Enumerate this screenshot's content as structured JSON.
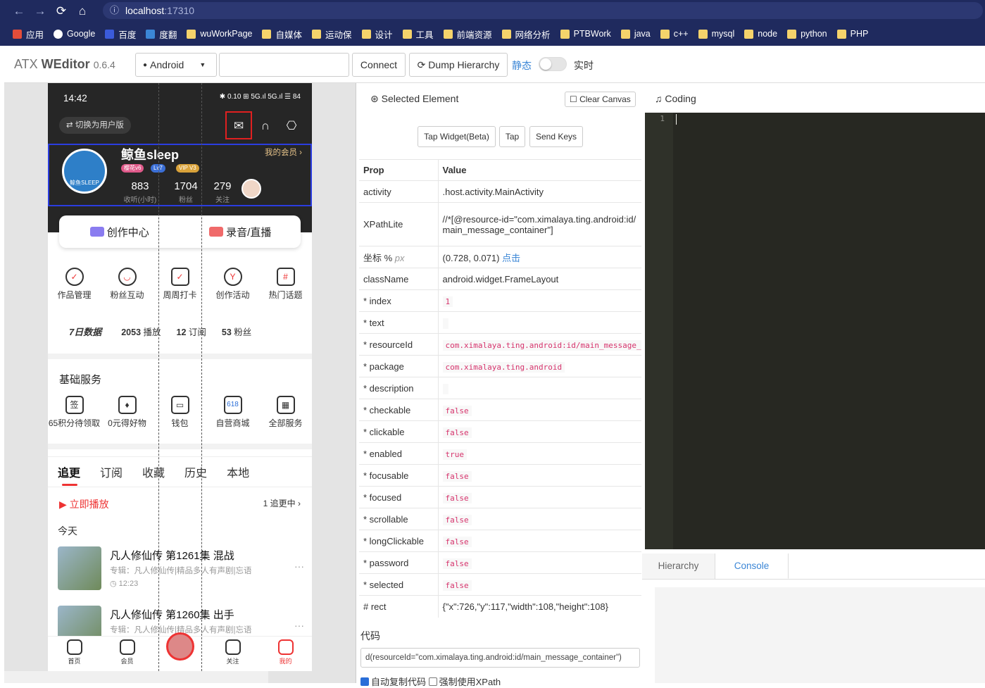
{
  "browser": {
    "url_host": "localhost",
    "url_port": ":17310",
    "nav": [
      "←",
      "→",
      "⟳",
      "⌂"
    ]
  },
  "bookmarks": [
    {
      "label": "应用",
      "icon": "apps-grid-icon",
      "color": "#e44d3a"
    },
    {
      "label": "Google",
      "icon": "google-icon",
      "color": "#ffffff"
    },
    {
      "label": "百度",
      "icon": "baidu-icon",
      "color": "#3b5bdb"
    },
    {
      "label": "度翻",
      "icon": "fanyi-icon",
      "color": "#3b86d6"
    },
    {
      "label": "wuWorkPage",
      "icon": "folder-icon"
    },
    {
      "label": "自媒体",
      "icon": "folder-icon"
    },
    {
      "label": "运动保",
      "icon": "folder-icon"
    },
    {
      "label": "设计",
      "icon": "folder-icon"
    },
    {
      "label": "工具",
      "icon": "folder-icon"
    },
    {
      "label": "前端资源",
      "icon": "folder-icon"
    },
    {
      "label": "网络分析",
      "icon": "folder-icon"
    },
    {
      "label": "PTBWork",
      "icon": "folder-icon"
    },
    {
      "label": "java",
      "icon": "folder-icon"
    },
    {
      "label": "c++",
      "icon": "folder-icon"
    },
    {
      "label": "mysql",
      "icon": "folder-icon"
    },
    {
      "label": "node",
      "icon": "folder-icon"
    },
    {
      "label": "python",
      "icon": "folder-icon"
    },
    {
      "label": "PHP",
      "icon": "folder-icon"
    }
  ],
  "app": {
    "brand_light": "ATX ",
    "brand_bold": "WEditor",
    "version": "0.6.4",
    "platform": "Android",
    "connect": "Connect",
    "dump": "Dump Hierarchy",
    "static_label": "静态",
    "realtime_label": "实时",
    "serial_placeholder": ""
  },
  "phone": {
    "time": "14:42",
    "status_icons": "✱ 0.10 ⊞ 5G.ıl 5G.ıl ☰ 84",
    "switch_user": "切换为用户版",
    "username": "鲸鱼sleep",
    "member": "我的会员 ›",
    "badges": [
      "樱花v6",
      "Lv7",
      "VIP V3"
    ],
    "stats": [
      {
        "n": "883",
        "l": "收听(小时)"
      },
      {
        "n": "1704",
        "l": "粉丝"
      },
      {
        "n": "279",
        "l": "关注"
      }
    ],
    "avatar_text": "鲸鱼SLEEP",
    "create": [
      {
        "label": "创作中心"
      },
      {
        "label": "录音/直播"
      }
    ],
    "tools": [
      {
        "label": "作品管理",
        "icon": "✓"
      },
      {
        "label": "粉丝互动",
        "icon": "◡"
      },
      {
        "label": "周周打卡",
        "icon": "✓"
      },
      {
        "label": "创作活动",
        "icon": "Y"
      },
      {
        "label": "热门话题",
        "icon": "#"
      }
    ],
    "data7": {
      "title": "7日数据",
      "items": [
        {
          "n": "2053",
          "l": " 播放"
        },
        {
          "n": "12",
          "l": " 订阅"
        },
        {
          "n": "53",
          "l": " 粉丝"
        }
      ]
    },
    "basic_title": "基础服务",
    "services": [
      {
        "label": "65积分待领取",
        "icon": "签"
      },
      {
        "label": "0元得好物",
        "icon": "♦"
      },
      {
        "label": "钱包",
        "icon": "▭"
      },
      {
        "label": "自营商城",
        "icon": "618"
      },
      {
        "label": "全部服务",
        "icon": "▦"
      }
    ],
    "tabs": [
      "追更",
      "订阅",
      "收藏",
      "历史",
      "本地"
    ],
    "playnow": "▶ 立即播放",
    "follow_count": "1 追更中 ›",
    "today": "今天",
    "episodes": [
      {
        "title": "凡人修仙传 第1261集 混战",
        "sub": "专辑：凡人修仙传|精品多人有声剧|忘语",
        "dur": "◷ 12:23"
      },
      {
        "title": "凡人修仙传 第1260集 出手",
        "sub": "专辑：凡人修仙传|精品多人有声剧|忘语",
        "dur": ""
      }
    ],
    "bottom_nav": [
      "首页",
      "会员",
      "",
      "关注",
      "我的"
    ]
  },
  "selected": {
    "title": "Selected Element",
    "clear": "Clear Canvas",
    "actions": [
      "Tap Widget(Beta)",
      "Tap",
      "Send Keys"
    ]
  },
  "props": {
    "head_prop": "Prop",
    "head_value": "Value",
    "rows": [
      {
        "k": "activity",
        "v": ".host.activity.MainActivity",
        "type": "text"
      },
      {
        "k": "XPathLite",
        "v": "//*[@resource-id=\"com.ximalaya.ting.android:id/main_message_container\"]",
        "type": "text"
      },
      {
        "k": "坐标 %",
        "v": "(0.728, 0.071)",
        "type": "coord",
        "unit": "px",
        "link": "点击"
      },
      {
        "k": "className",
        "v": "android.widget.FrameLayout",
        "type": "text"
      },
      {
        "k": "* index",
        "v": "1",
        "type": "code"
      },
      {
        "k": "* text",
        "v": "",
        "type": "code"
      },
      {
        "k": "* resourceId",
        "v": "com.ximalaya.ting.android:id/main_message_container",
        "type": "code"
      },
      {
        "k": "* package",
        "v": "com.ximalaya.ting.android",
        "type": "code"
      },
      {
        "k": "* description",
        "v": "",
        "type": "code"
      },
      {
        "k": "* checkable",
        "v": "false",
        "type": "code"
      },
      {
        "k": "* clickable",
        "v": "false",
        "type": "code"
      },
      {
        "k": "* enabled",
        "v": "true",
        "type": "code"
      },
      {
        "k": "* focusable",
        "v": "false",
        "type": "code"
      },
      {
        "k": "* focused",
        "v": "false",
        "type": "code"
      },
      {
        "k": "* scrollable",
        "v": "false",
        "type": "code"
      },
      {
        "k": "* longClickable",
        "v": "false",
        "type": "code"
      },
      {
        "k": "* password",
        "v": "false",
        "type": "code"
      },
      {
        "k": "* selected",
        "v": "false",
        "type": "code"
      },
      {
        "k": "# rect",
        "v": "{\"x\":726,\"y\":117,\"width\":108,\"height\":108}",
        "type": "text"
      }
    ]
  },
  "code": {
    "label": "代码",
    "value": "d(resourceId=\"com.ximalaya.ting.android:id/main_message_container\")",
    "auto_copy": "自动复制代码",
    "force_xpath": "强制使用XPath"
  },
  "coding": {
    "title": "♫ Coding",
    "line": "1"
  },
  "bottom_tabs": [
    "Hierarchy",
    "Console"
  ]
}
